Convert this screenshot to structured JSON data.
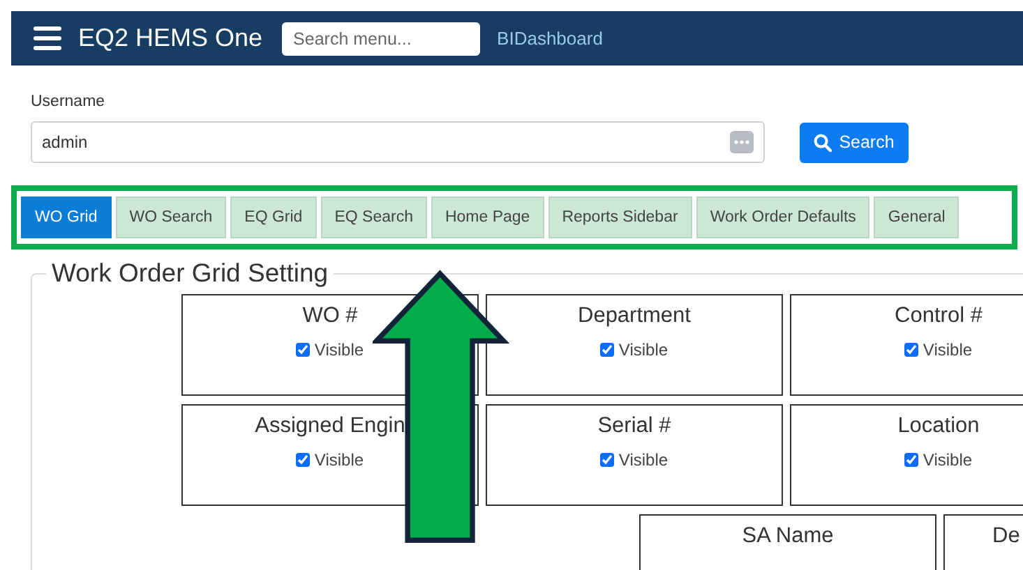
{
  "navbar": {
    "title": "EQ2 HEMS One",
    "search": {
      "placeholder": "Search menu..."
    },
    "link": "BIDashboard"
  },
  "username": {
    "label": "Username",
    "value": "admin"
  },
  "search_button": "Search",
  "tabs": [
    {
      "label": "WO Grid",
      "selected": true
    },
    {
      "label": "WO Search",
      "selected": false
    },
    {
      "label": "EQ Grid",
      "selected": false
    },
    {
      "label": "EQ Search",
      "selected": false
    },
    {
      "label": "Home Page",
      "selected": false
    },
    {
      "label": "Reports Sidebar",
      "selected": false
    },
    {
      "label": "Work Order Defaults",
      "selected": false
    },
    {
      "label": "General",
      "selected": false
    }
  ],
  "grid_setting": {
    "legend": "Work Order Grid Setting",
    "rows": [
      [
        {
          "label": "WO #",
          "visible_label": "Visible",
          "checked": true
        },
        {
          "label": "Department",
          "visible_label": "Visible",
          "checked": true
        },
        {
          "label": "Control #",
          "visible_label": "Visible",
          "checked": true
        }
      ],
      [
        {
          "label": "Assigned Engin",
          "visible_label": "Visible",
          "checked": true
        },
        {
          "label": "Serial #",
          "visible_label": "Visible",
          "checked": true
        },
        {
          "label": "Location",
          "visible_label": "Visible",
          "checked": true
        }
      ],
      [
        {
          "label": "SA Name"
        },
        {
          "label": "De"
        }
      ]
    ]
  }
}
